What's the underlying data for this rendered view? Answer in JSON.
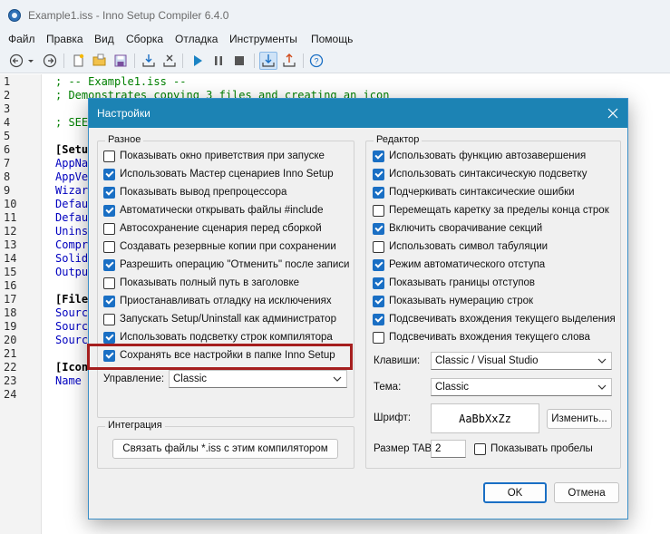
{
  "window": {
    "title": "Example1.iss - Inno Setup Compiler 6.4.0"
  },
  "menu": [
    "Файл",
    "Правка",
    "Вид",
    "Сборка",
    "Отладка",
    "Инструменты",
    "Помощь"
  ],
  "toolbar": {
    "icons": [
      "back-icon",
      "dropdown-arrow-icon",
      "forward-icon",
      "new-file-icon",
      "open-folder-icon",
      "save-icon",
      "compile-icon",
      "stop-compile-icon",
      "run-icon",
      "pause-icon",
      "stop-icon",
      "debug-step-icon",
      "debug-up-icon",
      "help-icon"
    ]
  },
  "editor": {
    "line_numbers": [
      "1",
      "2",
      "3",
      "4",
      "5",
      "6",
      "7",
      "8",
      "9",
      "10",
      "11",
      "12",
      "13",
      "14",
      "15",
      "16",
      "17",
      "18",
      "19",
      "20",
      "21",
      "22",
      "23",
      "24"
    ],
    "code_lines": [
      "; -- Example1.iss --",
      "; Demonstrates copying 3 files and creating an icon",
      "",
      "; SEE",
      "",
      "[Setu",
      "AppNa",
      "AppVe",
      "Wizar",
      "Defau",
      "Defau",
      "Unins",
      "Compr",
      "Solid",
      "Outpu",
      "",
      "[File",
      "Sourc",
      "Sourc",
      "Sourc",
      "",
      "[Icon",
      "Name",
      ""
    ]
  },
  "dialog": {
    "title": "Настройки",
    "misc_group": {
      "label": "Разное",
      "checkboxes": [
        {
          "label": "Показывать окно приветствия при запуске",
          "checked": false
        },
        {
          "label": "Использовать Мастер сценариев Inno Setup",
          "checked": true
        },
        {
          "label": "Показывать вывод препроцессора",
          "checked": true
        },
        {
          "label": "Автоматически открывать файлы #include",
          "checked": true
        },
        {
          "label": "Автосохранение сценария перед сборкой",
          "checked": false
        },
        {
          "label": "Создавать резервные копии при сохранении",
          "checked": false
        },
        {
          "label": "Разрешить операцию \"Отменить\" после записи",
          "checked": true
        },
        {
          "label": "Показывать полный путь в заголовке",
          "checked": false
        },
        {
          "label": "Приостанавливать отладку на исключениях",
          "checked": true
        },
        {
          "label": "Запускать Setup/Uninstall как администратор",
          "checked": false
        },
        {
          "label": "Использовать подсветку строк компилятора",
          "checked": true
        },
        {
          "label": "Сохранять все настройки в папке Inno Setup",
          "checked": true
        }
      ],
      "control_label": "Управление:",
      "control_value": "Classic"
    },
    "integration_group": {
      "label": "Интеграция",
      "associate_button": "Связать файлы *.iss с этим компилятором"
    },
    "editor_group": {
      "label": "Редактор",
      "checkboxes": [
        {
          "label": "Использовать функцию автозавершения",
          "checked": true
        },
        {
          "label": "Использовать синтаксическую подсветку",
          "checked": true
        },
        {
          "label": "Подчеркивать синтаксические ошибки",
          "checked": true
        },
        {
          "label": "Перемещать каретку за пределы конца строк",
          "checked": false
        },
        {
          "label": "Включить сворачивание секций",
          "checked": true
        },
        {
          "label": "Использовать символ табуляции",
          "checked": false
        },
        {
          "label": "Режим автоматического отступа",
          "checked": true
        },
        {
          "label": "Показывать границы отступов",
          "checked": true
        },
        {
          "label": "Показывать нумерацию строк",
          "checked": true
        },
        {
          "label": "Подсвечивать вхождения текущего выделения",
          "checked": true
        },
        {
          "label": "Подсвечивать вхождения текущего слова",
          "checked": false
        }
      ],
      "keys_label": "Клавиши:",
      "keys_value": "Classic / Visual Studio",
      "theme_label": "Тема:",
      "theme_value": "Classic",
      "font_label": "Шрифт:",
      "font_preview": "AaBbXxZz",
      "font_button": "Изменить...",
      "tab_size_label": "Размер TAB:",
      "tab_size_value": "2",
      "show_spaces_label": "Показывать пробелы",
      "show_spaces_checked": false
    },
    "ok_button": "OK",
    "cancel_button": "Отмена"
  },
  "colors": {
    "dialog_title_bar": "#1c83b4",
    "checkbox_checked": "#1a6fc4",
    "highlight_border": "#a51e1e",
    "code_comment": "#008000",
    "code_key": "#0000c0"
  }
}
